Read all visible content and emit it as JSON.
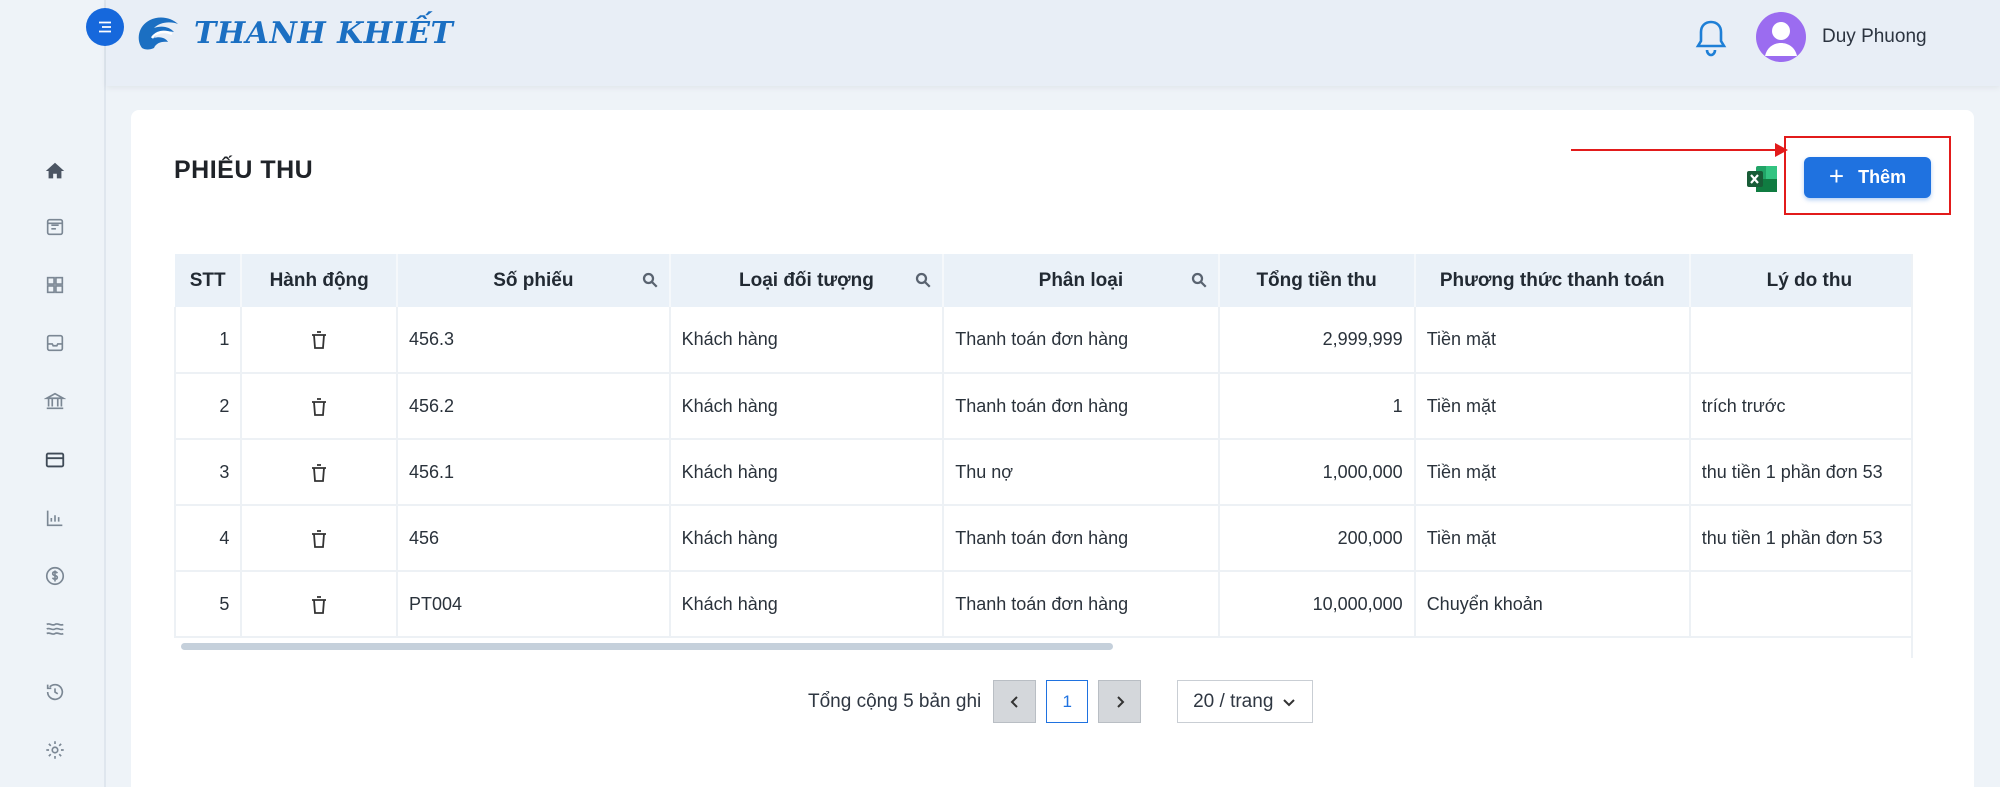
{
  "app": {
    "brand": "THANH KHIẾT",
    "user_name": "Duy Phuong"
  },
  "sidebar": {
    "items": [
      {
        "icon": "home-icon"
      },
      {
        "icon": "receipt-icon"
      },
      {
        "icon": "grid-icon"
      },
      {
        "icon": "inbox-icon"
      },
      {
        "icon": "bank-icon"
      },
      {
        "icon": "wallet-icon",
        "active": true
      },
      {
        "icon": "bar-chart-icon"
      },
      {
        "icon": "dollar-icon"
      },
      {
        "icon": "waves-icon"
      },
      {
        "icon": "history-icon"
      },
      {
        "icon": "settings-icon"
      }
    ]
  },
  "page": {
    "title": "PHIẾU THU",
    "add_button": "Thêm"
  },
  "table": {
    "columns": [
      "STT",
      "Hành động",
      "Số phiếu",
      "Loại đối tượng",
      "Phân loại",
      "Tổng tiền thu",
      "Phương thức thanh toán",
      "Lý do thu"
    ],
    "rows": [
      {
        "stt": "1",
        "so_phieu": "456.3",
        "loai_doi_tuong": "Khách hàng",
        "phan_loai": "Thanh toán đơn hàng",
        "tong_tien": "2,999,999",
        "phuong_thuc": "Tiền mặt",
        "ly_do": ""
      },
      {
        "stt": "2",
        "so_phieu": "456.2",
        "loai_doi_tuong": "Khách hàng",
        "phan_loai": "Thanh toán đơn hàng",
        "tong_tien": "1",
        "phuong_thuc": "Tiền mặt",
        "ly_do": "trích trước"
      },
      {
        "stt": "3",
        "so_phieu": "456.1",
        "loai_doi_tuong": "Khách hàng",
        "phan_loai": "Thu nợ",
        "tong_tien": "1,000,000",
        "phuong_thuc": "Tiền mặt",
        "ly_do": "thu tiền 1 phần đơn 53"
      },
      {
        "stt": "4",
        "so_phieu": "456",
        "loai_doi_tuong": "Khách hàng",
        "phan_loai": "Thanh toán đơn hàng",
        "tong_tien": "200,000",
        "phuong_thuc": "Tiền mặt",
        "ly_do": "thu tiền 1 phần đơn 53"
      },
      {
        "stt": "5",
        "so_phieu": "PT004",
        "loai_doi_tuong": "Khách hàng",
        "phan_loai": "Thanh toán đơn hàng",
        "tong_tien": "10,000,000",
        "phuong_thuc": "Chuyển khoản",
        "ly_do": ""
      }
    ]
  },
  "pagination": {
    "total_text": "Tổng cộng 5 bản ghi",
    "current_page": "1",
    "page_size": "20 / trang"
  },
  "colors": {
    "primary": "#1f72e0",
    "annotation": "#e21b1b",
    "header_bg": "#eaf1f8"
  }
}
